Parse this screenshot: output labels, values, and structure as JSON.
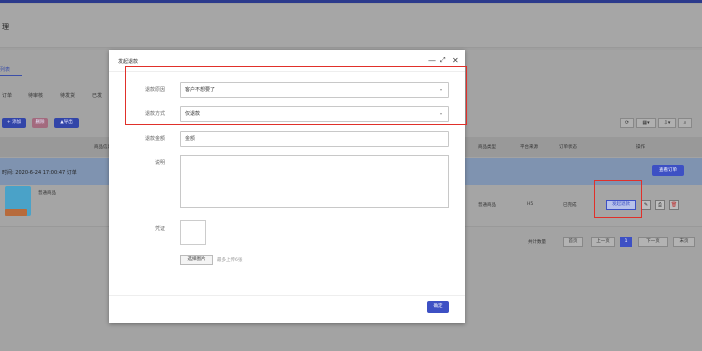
{
  "page": {
    "title": "理",
    "list_tab": "列表",
    "filters": [
      "订单",
      "待审核",
      "待发货",
      "已发"
    ],
    "toolbar": {
      "add": "+ 添加",
      "delete": "删除",
      "export": "▲导出"
    },
    "grid_headers": [
      "商品信息",
      "商品类型",
      "平台来源",
      "订单状态",
      "操作"
    ],
    "group_row_text": "时间: 2020-6-24 17:00:47  订单",
    "view_order": "查看订单",
    "product_name": "普通商品",
    "product_type": "普通商品",
    "platform": "H5",
    "order_status": "已完成",
    "initiate_refund_btn": "发起退款",
    "pager": {
      "total": "共计数量",
      "first": "首页",
      "prev": "上一页",
      "current": "1",
      "next": "下一页",
      "last": "末页"
    }
  },
  "modal": {
    "title": "发起退款",
    "reason_label": "退款原因",
    "reason_value": "客户不想要了",
    "method_label": "退款方式",
    "method_value": "仅退款",
    "amount_label": "退款金额",
    "amount_placeholder": "金额",
    "note_label": "说明",
    "proof_label": "凭证",
    "select_image_btn": "选择图片",
    "upload_hint": "最多上传6张",
    "confirm_btn": "确定"
  },
  "colors": {
    "accent": "#3d50c4",
    "highlight": "#e0302a"
  }
}
